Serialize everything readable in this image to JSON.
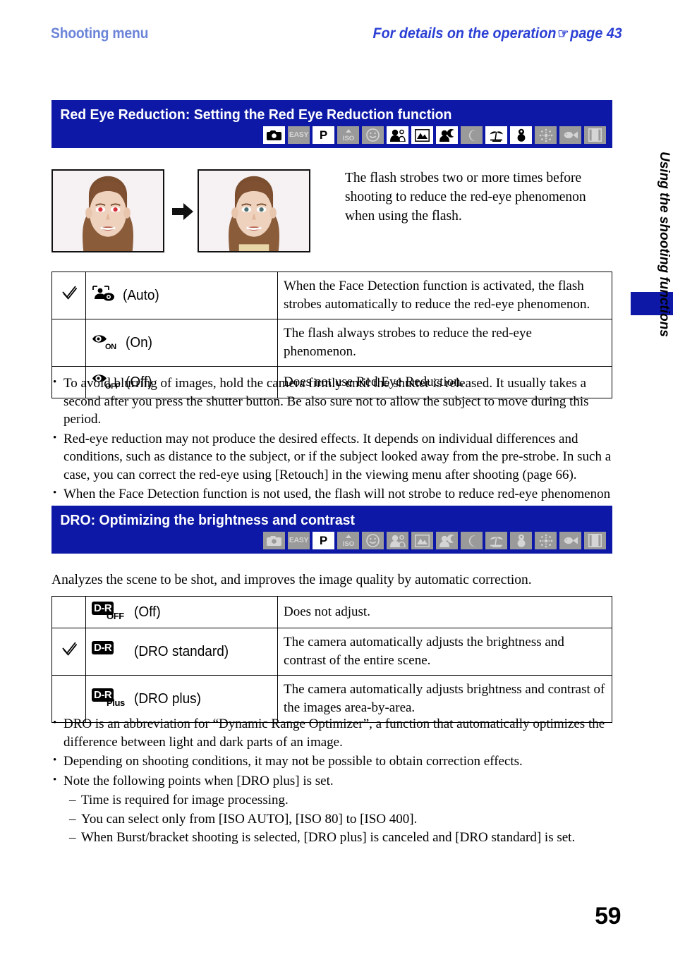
{
  "header": {
    "left_title": "Shooting menu",
    "right_title_pre": "For details on the operation",
    "hand_icon": "☞",
    "right_title_post": "page 43"
  },
  "colors": {
    "banner_blue": "#0d19a6",
    "head_left_blue": "#6b84d8",
    "head_right_blue": "#2b3fd4",
    "icon_off_gray": "#9a9a9a"
  },
  "sections": [
    {
      "banner_title": "Red Eye Reduction: Setting the Red Eye Reduction function",
      "mode_icons": [
        {
          "name": "camera-icon",
          "label": "Camera",
          "active": true
        },
        {
          "name": "easy-shooting-icon",
          "label": "EASY",
          "active": false
        },
        {
          "name": "program-auto-icon",
          "label": "P",
          "active": true
        },
        {
          "name": "iso-high-sensitivity-icon",
          "label": "ISO",
          "active": false
        },
        {
          "name": "smile-shutter-icon",
          "label": "Smile",
          "active": false
        },
        {
          "name": "soft-snap-icon",
          "label": "Soft Snap",
          "active": true
        },
        {
          "name": "landscape-icon",
          "label": "Landscape",
          "active": true
        },
        {
          "name": "twilight-portrait-icon",
          "label": "Twilight Portrait",
          "active": true
        },
        {
          "name": "twilight-icon",
          "label": "Twilight",
          "active": false
        },
        {
          "name": "beach-icon",
          "label": "Beach",
          "active": true
        },
        {
          "name": "snow-icon",
          "label": "Snow",
          "active": true
        },
        {
          "name": "fireworks-icon",
          "label": "Fireworks",
          "active": false
        },
        {
          "name": "underwater-icon",
          "label": "Underwater",
          "active": false
        },
        {
          "name": "movie-mode-icon",
          "label": "Movie",
          "active": false
        }
      ],
      "figure": {
        "before_alt": "Portrait with red eyes",
        "after_alt": "Portrait with red eyes reduced",
        "caption": "The flash strobes two or more times before shooting to reduce the red-eye phenomenon when using the flash."
      },
      "table_rows": [
        {
          "checked": true,
          "icon": "red-eye-auto-icon",
          "icon_sub": "",
          "option": "(Auto)",
          "description": "When the Face Detection function is activated, the flash strobes automatically to reduce the red-eye phenomenon."
        },
        {
          "checked": false,
          "icon": "red-eye-on-icon",
          "icon_sub": "ON",
          "option": "(On)",
          "description": "The flash always strobes to reduce the red-eye phenomenon."
        },
        {
          "checked": false,
          "icon": "red-eye-off-icon",
          "icon_sub": "OFF",
          "option": "(Off)",
          "description": "Does not use Red Eye Reduction."
        }
      ],
      "notes": [
        {
          "level": "bullet",
          "text": "To avoid blurring of images, hold the camera firmly until the shutter is released. It usually takes a second after you press the shutter button. Be also sure not to allow the subject to move during this period."
        },
        {
          "level": "bullet",
          "text": "Red-eye reduction may not produce the desired effects. It depends on individual differences and conditions, such as distance to the subject, or if the subject looked away from the pre-strobe. In such a case, you can correct the red-eye using [Retouch] in the viewing menu after shooting (page 66)."
        },
        {
          "level": "bullet",
          "text": "When the Face Detection function is not used, the flash will not strobe to reduce red-eye phenomenon even when [Auto] is selected."
        }
      ]
    },
    {
      "banner_title": "DRO: Optimizing the brightness and contrast",
      "mode_icons": [
        {
          "name": "camera-icon",
          "label": "Camera",
          "active": false
        },
        {
          "name": "easy-shooting-icon",
          "label": "EASY",
          "active": false
        },
        {
          "name": "program-auto-icon",
          "label": "P",
          "active": true
        },
        {
          "name": "iso-high-sensitivity-icon",
          "label": "ISO",
          "active": false
        },
        {
          "name": "smile-shutter-icon",
          "label": "Smile",
          "active": false
        },
        {
          "name": "soft-snap-icon",
          "label": "Soft Snap",
          "active": false
        },
        {
          "name": "landscape-icon",
          "label": "Landscape",
          "active": false
        },
        {
          "name": "twilight-portrait-icon",
          "label": "Twilight Portrait",
          "active": false
        },
        {
          "name": "twilight-icon",
          "label": "Twilight",
          "active": false
        },
        {
          "name": "beach-icon",
          "label": "Beach",
          "active": false
        },
        {
          "name": "snow-icon",
          "label": "Snow",
          "active": false
        },
        {
          "name": "fireworks-icon",
          "label": "Fireworks",
          "active": false
        },
        {
          "name": "underwater-icon",
          "label": "Underwater",
          "active": false
        },
        {
          "name": "movie-mode-icon",
          "label": "Movie",
          "active": false
        }
      ],
      "intro": "Analyzes the scene to be shot, and improves the image quality by automatic correction.",
      "table_rows": [
        {
          "checked": false,
          "icon": "dro-off-icon",
          "badge": "D-R",
          "icon_sub": "OFF",
          "option": "(Off)",
          "description": "Does not adjust."
        },
        {
          "checked": true,
          "icon": "dro-standard-icon",
          "badge": "D-R",
          "icon_sub": "",
          "option": "(DRO standard)",
          "description": "The camera automatically adjusts the brightness and contrast of the entire scene."
        },
        {
          "checked": false,
          "icon": "dro-plus-icon",
          "badge": "D-R",
          "icon_sub": "Plus",
          "option": "(DRO plus)",
          "description": "The camera automatically adjusts brightness and contrast of the images area-by-area."
        }
      ],
      "notes": [
        {
          "level": "bullet",
          "text": "DRO is an abbreviation for “Dynamic Range Optimizer”, a function that automatically optimizes the difference between light and dark parts of an image."
        },
        {
          "level": "bullet",
          "text": "Depending on shooting conditions, it may not be possible to obtain correction effects."
        },
        {
          "level": "bullet",
          "text": "Note the following points when [DRO plus] is set."
        },
        {
          "level": "sub",
          "text": "Time is required for image processing."
        },
        {
          "level": "sub",
          "text": "You can select only from [ISO AUTO], [ISO 80] to [ISO 400]."
        },
        {
          "level": "sub",
          "text": "When Burst/bracket shooting is selected, [DRO plus] is canceled and [DRO standard] is set."
        }
      ]
    }
  ],
  "side_tab": {
    "label": "Using the shooting functions"
  },
  "folio": "59"
}
